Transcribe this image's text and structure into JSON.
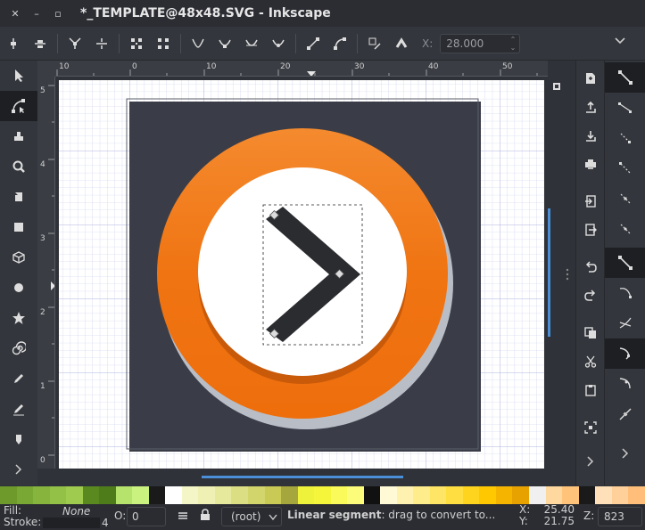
{
  "window": {
    "title": "*_TEMPLATE@48x48.SVG - Inkscape"
  },
  "toolbar": {
    "x_label": "X:",
    "x_value": "28.000"
  },
  "rulers": {
    "horizontal_ticks": [
      "10",
      "0",
      "10",
      "20",
      "30",
      "40",
      "50"
    ],
    "vertical_ticks": [
      "5",
      "4",
      "3",
      "2",
      "1",
      "0"
    ]
  },
  "tools": [
    "selector-tool",
    "node-tool",
    "tweak-tool",
    "zoom-tool",
    "measure-tool",
    "rect-tool",
    "3dbox-tool",
    "ellipse-tool",
    "star-tool",
    "spiral-tool",
    "pencil-tool",
    "pen-tool",
    "calligraphy-tool"
  ],
  "palette": {
    "colors": [
      "#6e9a2b",
      "#7aa834",
      "#86b43c",
      "#93c046",
      "#9fcb4f",
      "#5a8a1f",
      "#4f7c1a",
      "#b6e36c",
      "#c9f27e",
      "#1a1a1a",
      "#ffffff",
      "#f4f6c8",
      "#eef0b4",
      "#e6e89c",
      "#dcde84",
      "#d2d46c",
      "#c8ca55",
      "#a5a63c",
      "#eef23a",
      "#f5f53c",
      "#fafa5a",
      "#fcfc7a",
      "#111111",
      "#fff9d6",
      "#fff2b0",
      "#ffec8a",
      "#ffe566",
      "#ffde42",
      "#ffd41e",
      "#ffc800",
      "#f5b400",
      "#e8a200",
      "#f0f0f0",
      "#ffd8a0",
      "#ffc47a",
      "#1a1a1a",
      "#ffe0b8",
      "#ffd09a",
      "#ffbf7a"
    ]
  },
  "status": {
    "fill_label": "Fill:",
    "fill_value": "None",
    "stroke_label": "Stroke:",
    "stroke_width": "4",
    "opacity_label": "O:",
    "opacity_value": "0",
    "layer": "(root)",
    "message_bold": "Linear segment",
    "message_rest": ": drag to convert to...",
    "x_label": "X:",
    "x_value": "25.40",
    "y_label": "Y:",
    "y_value": "21.75",
    "zoom_label": "Z:",
    "zoom_value": "823"
  },
  "colors": {
    "ring_orange": "#f07412",
    "ring_shadow": "#c8cbd4",
    "chevron": "#2b2c30",
    "accent_blue": "#4a8fd8"
  }
}
